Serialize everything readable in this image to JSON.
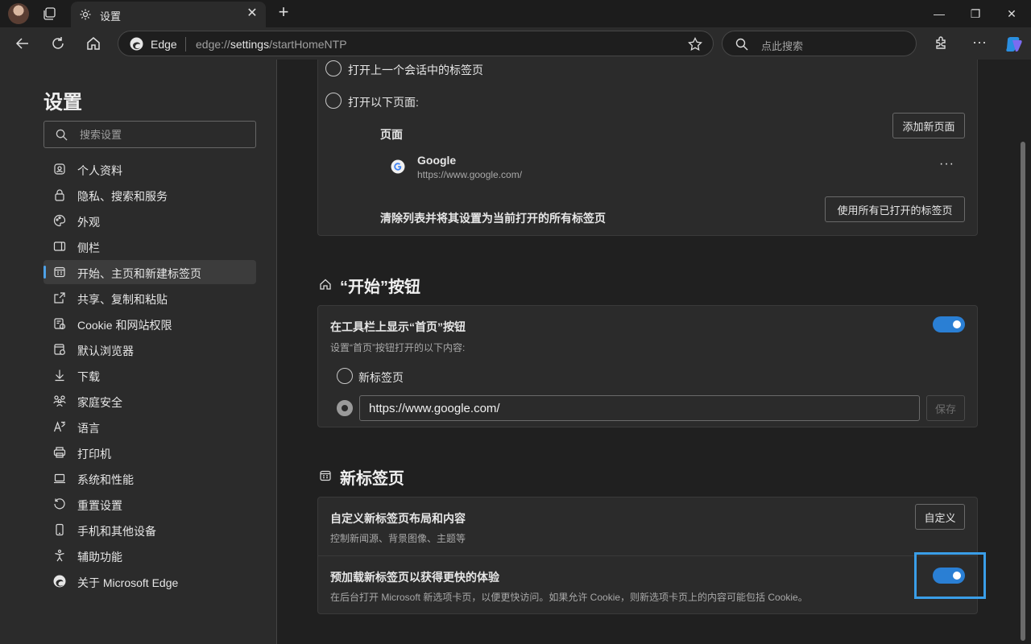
{
  "browser": {
    "tab_title": "设置",
    "brand": "Edge",
    "url_prefix": "edge://",
    "url_bold": "settings",
    "url_rest": "/startHomeNTP",
    "search_placeholder": "点此搜索"
  },
  "sidebar": {
    "title": "设置",
    "search_placeholder": "搜索设置",
    "items": [
      {
        "label": "个人资料",
        "icon": "profile-icon"
      },
      {
        "label": "隐私、搜索和服务",
        "icon": "lock-icon"
      },
      {
        "label": "外观",
        "icon": "palette-icon"
      },
      {
        "label": "侧栏",
        "icon": "sidebar-icon"
      },
      {
        "label": "开始、主页和新建标签页",
        "icon": "home-tab-icon",
        "active": true
      },
      {
        "label": "共享、复制和粘贴",
        "icon": "share-icon"
      },
      {
        "label": "Cookie 和网站权限",
        "icon": "cookie-icon"
      },
      {
        "label": "默认浏览器",
        "icon": "browser-icon"
      },
      {
        "label": "下载",
        "icon": "download-icon"
      },
      {
        "label": "家庭安全",
        "icon": "family-icon"
      },
      {
        "label": "语言",
        "icon": "language-icon"
      },
      {
        "label": "打印机",
        "icon": "printer-icon"
      },
      {
        "label": "系统和性能",
        "icon": "laptop-icon"
      },
      {
        "label": "重置设置",
        "icon": "reset-icon"
      },
      {
        "label": "手机和其他设备",
        "icon": "phone-icon"
      },
      {
        "label": "辅助功能",
        "icon": "accessibility-icon"
      },
      {
        "label": "关于 Microsoft Edge",
        "icon": "edge-icon"
      }
    ]
  },
  "startup": {
    "option_last_session": "打开上一个会话中的标签页",
    "option_open_pages": "打开以下页面:",
    "pages_label": "页面",
    "add_page_button": "添加新页面",
    "page_entry": {
      "name": "Google",
      "url": "https://www.google.com/"
    },
    "clear_list_text": "清除列表并将其设置为当前打开的所有标签页",
    "use_all_tabs_button": "使用所有已打开的标签页"
  },
  "home_button": {
    "heading": "“开始”按钮",
    "show_label": "在工具栏上显示“首页”按钮",
    "show_enabled": true,
    "sub_label": "设置“首页”按钮打开的以下内容:",
    "option_new_tab": "新标签页",
    "url_value": "https://www.google.com/",
    "save_button": "保存"
  },
  "new_tab": {
    "heading": "新标签页",
    "customize_title": "自定义新标签页布局和内容",
    "customize_sub": "控制新闻源、背景图像、主题等",
    "customize_button": "自定义",
    "preload_title": "预加载新标签页以获得更快的体验",
    "preload_sub": "在后台打开 Microsoft 新选项卡页，以便更快访问。如果允许 Cookie，则新选项卡页上的内容可能包括 Cookie。",
    "preload_enabled": true
  },
  "colors": {
    "accent": "#2a7fd4",
    "highlight": "#3a9ee8"
  }
}
